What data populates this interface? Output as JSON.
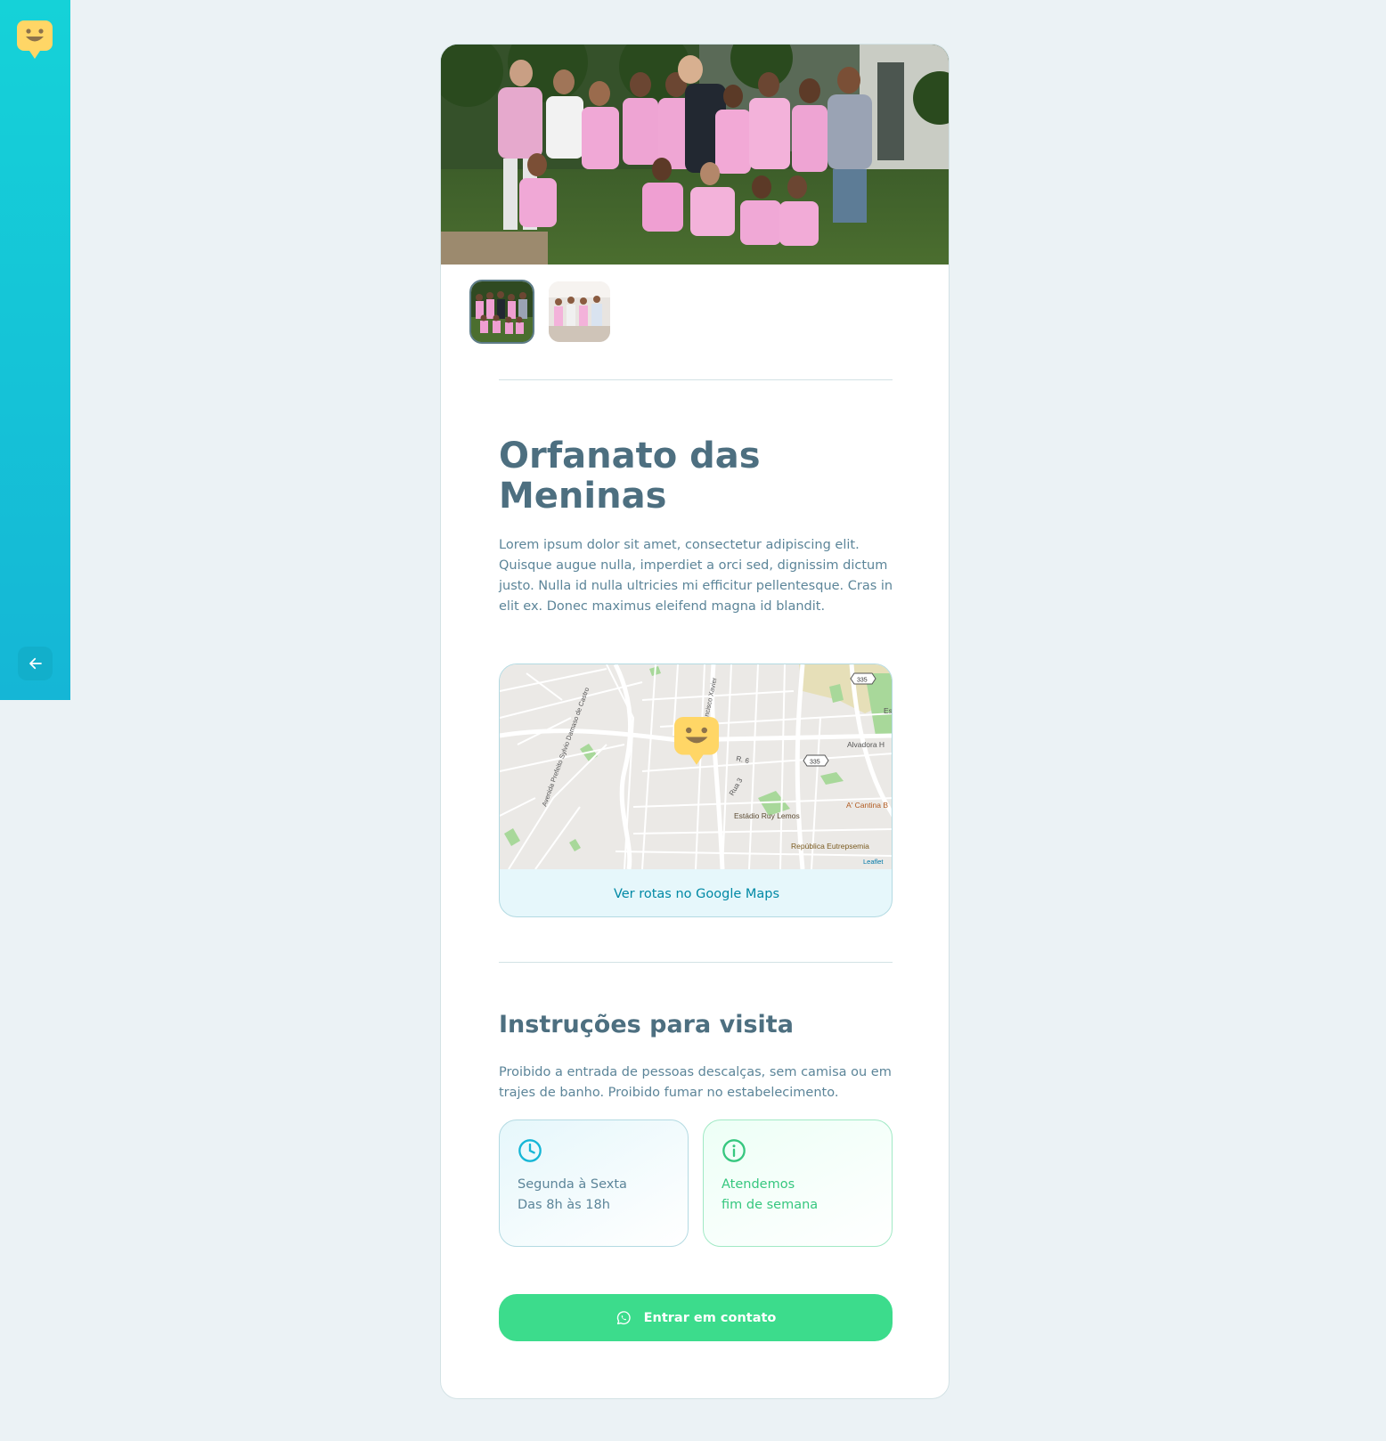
{
  "orphanage": {
    "name": "Orfanato das Meninas",
    "about": "Lorem ipsum dolor sit amet, consectetur adipiscing elit. Quisque augue nulla, imperdiet a orci sed, dignissim dictum justo. Nulla id nulla ultricies mi efficitur pellentesque. Cras in elit ex. Donec maximus eleifend magna id blandit."
  },
  "gallery": {
    "images": [
      "group-photo-garden",
      "group-photo-indoors"
    ],
    "active_index": 0
  },
  "map": {
    "labels": {
      "avenue": "Avenida Prefeito Sylvio Damaso de Castro",
      "street_francisco": "Francisco Xavier",
      "r6": "R. 6",
      "rua3": "Rua 3",
      "stadium": "Estádio Ruy Lemos",
      "republica": "República Eutrepsemia",
      "cantina": "A' Cantina B",
      "alvadora": "Alvadora H",
      "highway_a": "335",
      "highway_b": "335",
      "edge": "Es",
      "attribution": "Leaflet"
    },
    "link_label": "Ver rotas no Google Maps"
  },
  "instructions": {
    "heading": "Instruções para visita",
    "text": "Proibido a entrada de pessoas descalças, sem camisa ou em trajes de banho. Proibido fumar no estabelecimento."
  },
  "opening_hours": {
    "line1": "Segunda à Sexta",
    "line2": "Das 8h às 18h",
    "icon": "clock-icon",
    "color": "#15b6d6"
  },
  "weekends": {
    "line1": "Atendemos",
    "line2": "fim de semana",
    "icon": "info-icon",
    "color": "#37c77f"
  },
  "contact": {
    "label": "Entrar em contato",
    "icon": "whatsapp-icon",
    "color": "#3cdc8c"
  },
  "theme": {
    "sidebar_gradient": [
      "#15d2d8",
      "#15b6d6"
    ],
    "marker_color": "#ffd666",
    "title_color": "#4d6f80"
  }
}
